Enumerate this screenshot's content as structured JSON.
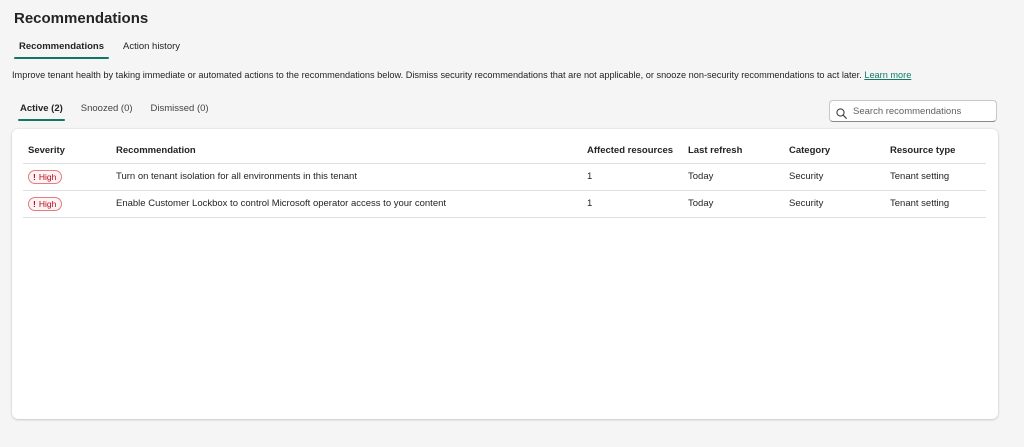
{
  "page": {
    "title": "Recommendations"
  },
  "main_tabs": [
    {
      "label": "Recommendations",
      "active": true
    },
    {
      "label": "Action history",
      "active": false
    }
  ],
  "description": {
    "text": "Improve tenant health by taking immediate or automated actions to the recommendations below. Dismiss security recommendations that are not applicable, or snooze non-security recommendations to act later. ",
    "link_label": "Learn more"
  },
  "sub_tabs": [
    {
      "label": "Active (2)",
      "active": true
    },
    {
      "label": "Snoozed (0)",
      "active": false
    },
    {
      "label": "Dismissed (0)",
      "active": false
    }
  ],
  "search": {
    "placeholder": "Search recommendations",
    "icon": "search-icon"
  },
  "table": {
    "columns": [
      "Severity",
      "Recommendation",
      "Affected resources",
      "Last refresh",
      "Category",
      "Resource type"
    ],
    "rows": [
      {
        "severity": "High",
        "severity_icon": "!",
        "recommendation": "Turn on tenant isolation for all environments in this tenant",
        "affected": "1",
        "refresh": "Today",
        "category": "Security",
        "resource_type": "Tenant setting"
      },
      {
        "severity": "High",
        "severity_icon": "!",
        "recommendation": "Enable Customer Lockbox to control Microsoft operator access to your content",
        "affected": "1",
        "refresh": "Today",
        "category": "Security",
        "resource_type": "Tenant setting"
      }
    ]
  },
  "colors": {
    "accent": "#117865",
    "severity_high_text": "#b10e1c",
    "severity_high_border": "#e37d80"
  }
}
